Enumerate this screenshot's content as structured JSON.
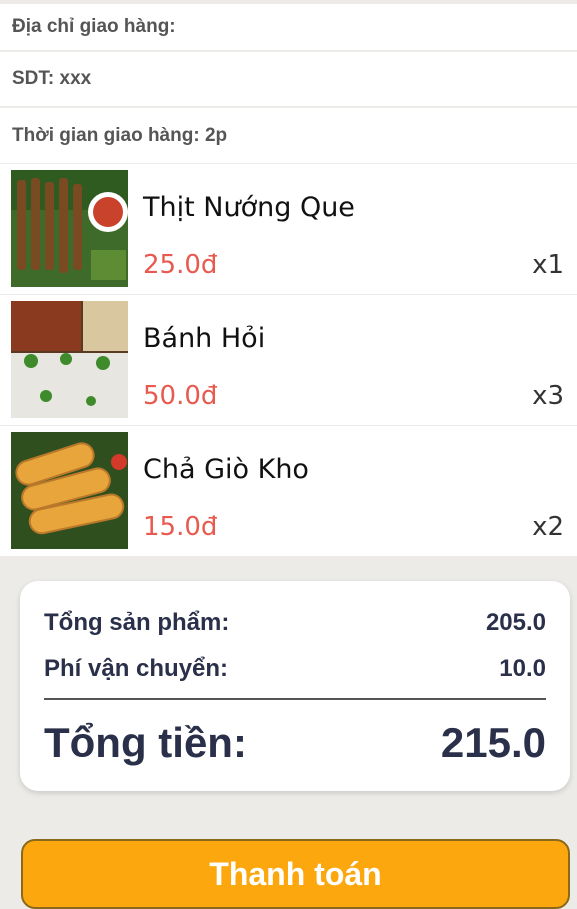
{
  "delivery": {
    "address_label": "Địa chỉ giao hàng:",
    "phone_label": "SDT: xxx",
    "time_label": "Thời gian giao hàng: 2p"
  },
  "items": [
    {
      "name": "Thịt Nướng Que",
      "price": "25.0đ",
      "qty": "x1"
    },
    {
      "name": "Bánh Hỏi",
      "price": "50.0đ",
      "qty": "x3"
    },
    {
      "name": "Chả Giò Kho",
      "price": "15.0đ",
      "qty": "x2"
    }
  ],
  "summary": {
    "subtotal_label": "Tổng sản phẩm:",
    "subtotal_value": "205.0",
    "shipping_label": "Phí vận chuyển:",
    "shipping_value": "10.0",
    "total_label": "Tổng tiền:",
    "total_value": "215.0"
  },
  "checkout": {
    "label": "Thanh toán"
  },
  "colors": {
    "price": "#e85a4f",
    "summary_text": "#2b304a",
    "button": "#fca70d",
    "background": "#ecebe8"
  }
}
